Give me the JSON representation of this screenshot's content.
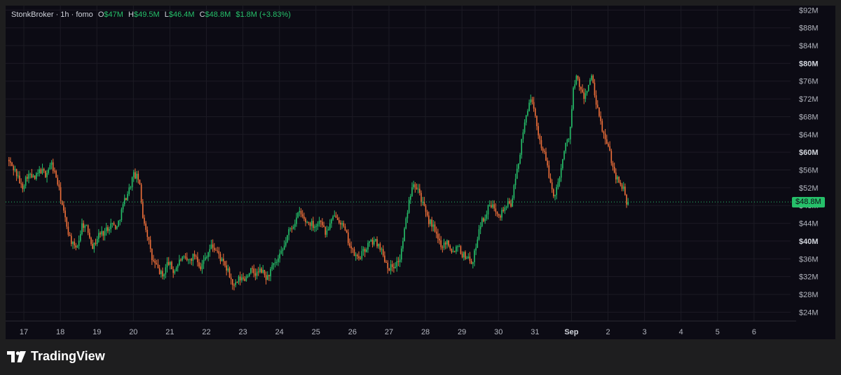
{
  "legend": {
    "symbol": "StonkBroker · 1h · fomo",
    "open_label": "O",
    "open": "$47M",
    "high_label": "H",
    "high": "$49.5M",
    "low_label": "L",
    "low": "$46.4M",
    "close_label": "C",
    "close": "$48.8M",
    "change": "$1.8M (+3.83%)"
  },
  "last_price_label": "$48.8M",
  "brand": {
    "name": "TradingView"
  },
  "colors": {
    "up": "#26c06a",
    "down": "#f0703a",
    "background": "#0c0b14",
    "grid": "#1c1b24"
  },
  "chart_data": {
    "type": "candlestick",
    "interval": "1h",
    "y_unit": "USD millions",
    "ylim": [
      22,
      93
    ],
    "y_ticks": [
      {
        "value": 92,
        "label": "$92M",
        "bold": false
      },
      {
        "value": 88,
        "label": "$88M",
        "bold": false
      },
      {
        "value": 84,
        "label": "$84M",
        "bold": false
      },
      {
        "value": 80,
        "label": "$80M",
        "bold": true
      },
      {
        "value": 76,
        "label": "$76M",
        "bold": false
      },
      {
        "value": 72,
        "label": "$72M",
        "bold": false
      },
      {
        "value": 68,
        "label": "$68M",
        "bold": false
      },
      {
        "value": 64,
        "label": "$64M",
        "bold": false
      },
      {
        "value": 60,
        "label": "$60M",
        "bold": true
      },
      {
        "value": 56,
        "label": "$56M",
        "bold": false
      },
      {
        "value": 52,
        "label": "$52M",
        "bold": false
      },
      {
        "value": 48,
        "label": "$48M",
        "bold": false
      },
      {
        "value": 44,
        "label": "$44M",
        "bold": false
      },
      {
        "value": 40,
        "label": "$40M",
        "bold": true
      },
      {
        "value": 36,
        "label": "$36M",
        "bold": false
      },
      {
        "value": 32,
        "label": "$32M",
        "bold": false
      },
      {
        "value": 28,
        "label": "$28M",
        "bold": false
      },
      {
        "value": 24,
        "label": "$24M",
        "bold": false
      }
    ],
    "x_ticks": [
      {
        "day": 0,
        "label": "17",
        "bold": false
      },
      {
        "day": 1,
        "label": "18",
        "bold": false
      },
      {
        "day": 2,
        "label": "19",
        "bold": false
      },
      {
        "day": 3,
        "label": "20",
        "bold": false
      },
      {
        "day": 4,
        "label": "21",
        "bold": false
      },
      {
        "day": 5,
        "label": "22",
        "bold": false
      },
      {
        "day": 6,
        "label": "23",
        "bold": false
      },
      {
        "day": 7,
        "label": "24",
        "bold": false
      },
      {
        "day": 8,
        "label": "25",
        "bold": false
      },
      {
        "day": 9,
        "label": "26",
        "bold": false
      },
      {
        "day": 10,
        "label": "27",
        "bold": false
      },
      {
        "day": 11,
        "label": "28",
        "bold": false
      },
      {
        "day": 12,
        "label": "29",
        "bold": false
      },
      {
        "day": 13,
        "label": "30",
        "bold": false
      },
      {
        "day": 14,
        "label": "31",
        "bold": false
      },
      {
        "day": 15,
        "label": "Sep",
        "bold": true
      },
      {
        "day": 16,
        "label": "2",
        "bold": false
      },
      {
        "day": 17,
        "label": "3",
        "bold": false
      },
      {
        "day": 18,
        "label": "4",
        "bold": false
      },
      {
        "day": 19,
        "label": "5",
        "bold": false
      },
      {
        "day": 20,
        "label": "6",
        "bold": false
      }
    ],
    "xlim": [
      -0.5,
      21.0
    ],
    "last_close": 48.8,
    "close_path": [
      [
        -0.45,
        58.3
      ],
      [
        -0.25,
        56.0
      ],
      [
        -0.05,
        52.0
      ],
      [
        0.1,
        55.0
      ],
      [
        0.3,
        54.0
      ],
      [
        0.45,
        56.0
      ],
      [
        0.6,
        55.0
      ],
      [
        0.75,
        57.5
      ],
      [
        0.9,
        54.0
      ],
      [
        1.0,
        50.0
      ],
      [
        1.1,
        46.0
      ],
      [
        1.25,
        41.0
      ],
      [
        1.4,
        38.0
      ],
      [
        1.5,
        40.0
      ],
      [
        1.6,
        44.0
      ],
      [
        1.75,
        42.5
      ],
      [
        1.9,
        38.5
      ],
      [
        2.05,
        41.5
      ],
      [
        2.2,
        42.0
      ],
      [
        2.4,
        44.0
      ],
      [
        2.55,
        43.0
      ],
      [
        2.75,
        49.0
      ],
      [
        2.9,
        52.0
      ],
      [
        3.0,
        55.0
      ],
      [
        3.15,
        54.0
      ],
      [
        3.25,
        46.0
      ],
      [
        3.4,
        41.0
      ],
      [
        3.5,
        36.0
      ],
      [
        3.65,
        34.0
      ],
      [
        3.8,
        32.0
      ],
      [
        3.95,
        35.5
      ],
      [
        4.1,
        33.0
      ],
      [
        4.3,
        36.0
      ],
      [
        4.5,
        35.5
      ],
      [
        4.7,
        37.0
      ],
      [
        4.85,
        34.0
      ],
      [
        5.0,
        37.0
      ],
      [
        5.15,
        39.0
      ],
      [
        5.3,
        37.5
      ],
      [
        5.45,
        35.0
      ],
      [
        5.6,
        33.0
      ],
      [
        5.75,
        29.5
      ],
      [
        5.9,
        31.5
      ],
      [
        6.05,
        31.5
      ],
      [
        6.2,
        33.5
      ],
      [
        6.35,
        32.5
      ],
      [
        6.5,
        33.5
      ],
      [
        6.65,
        31.5
      ],
      [
        6.8,
        34.0
      ],
      [
        6.95,
        35.5
      ],
      [
        7.1,
        38.0
      ],
      [
        7.25,
        42.0
      ],
      [
        7.4,
        44.0
      ],
      [
        7.55,
        46.5
      ],
      [
        7.7,
        44.5
      ],
      [
        7.85,
        44.0
      ],
      [
        8.0,
        43.5
      ],
      [
        8.15,
        45.0
      ],
      [
        8.25,
        41.5
      ],
      [
        8.4,
        44.0
      ],
      [
        8.55,
        46.0
      ],
      [
        8.7,
        44.0
      ],
      [
        8.85,
        41.0
      ],
      [
        9.0,
        37.5
      ],
      [
        9.15,
        36.0
      ],
      [
        9.3,
        37.5
      ],
      [
        9.45,
        39.5
      ],
      [
        9.6,
        40.0
      ],
      [
        9.75,
        39.0
      ],
      [
        9.85,
        36.5
      ],
      [
        10.0,
        34.0
      ],
      [
        10.15,
        34.5
      ],
      [
        10.3,
        36.0
      ],
      [
        10.4,
        41.0
      ],
      [
        10.55,
        49.0
      ],
      [
        10.65,
        53.5
      ],
      [
        10.8,
        52.0
      ],
      [
        10.9,
        49.0
      ],
      [
        11.05,
        45.0
      ],
      [
        11.2,
        43.5
      ],
      [
        11.3,
        41.0
      ],
      [
        11.45,
        39.0
      ],
      [
        11.6,
        40.0
      ],
      [
        11.75,
        37.5
      ],
      [
        11.9,
        39.5
      ],
      [
        12.0,
        37.0
      ],
      [
        12.15,
        36.5
      ],
      [
        12.3,
        35.0
      ],
      [
        12.4,
        40.0
      ],
      [
        12.5,
        44.0
      ],
      [
        12.6,
        45.0
      ],
      [
        12.75,
        48.0
      ],
      [
        12.9,
        47.5
      ],
      [
        13.05,
        46.0
      ],
      [
        13.2,
        48.0
      ],
      [
        13.35,
        48.5
      ],
      [
        13.45,
        53.0
      ],
      [
        13.55,
        58.0
      ],
      [
        13.65,
        63.0
      ],
      [
        13.75,
        68.0
      ],
      [
        13.85,
        72.0
      ],
      [
        13.95,
        70.0
      ],
      [
        14.05,
        66.0
      ],
      [
        14.15,
        62.0
      ],
      [
        14.25,
        60.0
      ],
      [
        14.35,
        56.0
      ],
      [
        14.45,
        52.0
      ],
      [
        14.55,
        50.0
      ],
      [
        14.65,
        54.0
      ],
      [
        14.75,
        58.0
      ],
      [
        14.85,
        62.0
      ],
      [
        14.95,
        64.0
      ],
      [
        15.05,
        74.0
      ],
      [
        15.15,
        77.0
      ],
      [
        15.25,
        74.0
      ],
      [
        15.35,
        72.0
      ],
      [
        15.45,
        75.0
      ],
      [
        15.55,
        77.0
      ],
      [
        15.65,
        72.0
      ],
      [
        15.75,
        68.0
      ],
      [
        15.85,
        65.0
      ],
      [
        15.95,
        62.0
      ],
      [
        16.05,
        60.0
      ],
      [
        16.15,
        56.0
      ],
      [
        16.25,
        54.0
      ],
      [
        16.35,
        53.0
      ],
      [
        16.45,
        51.0
      ],
      [
        16.5,
        48.0
      ],
      [
        16.55,
        48.8
      ]
    ]
  }
}
